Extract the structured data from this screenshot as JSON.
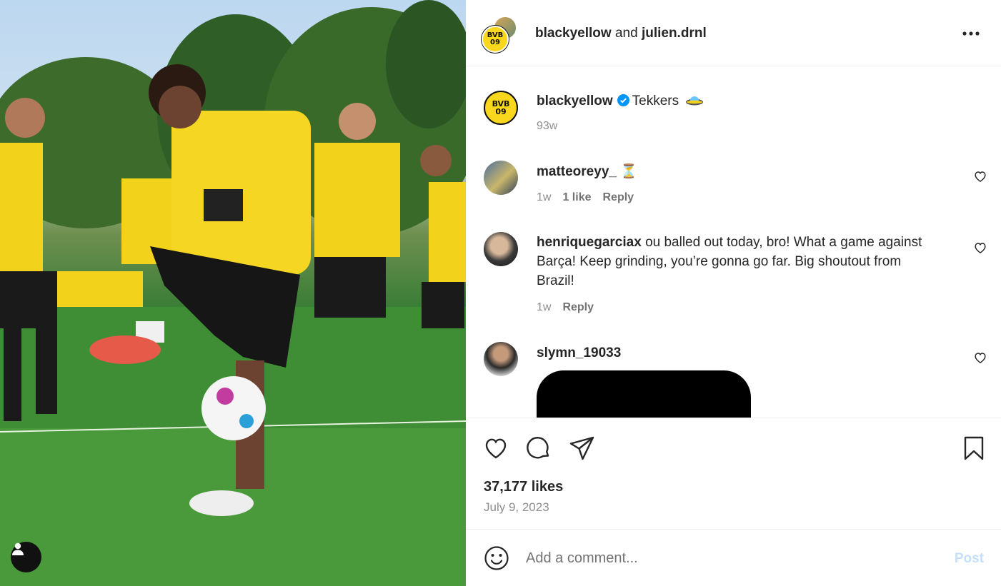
{
  "header": {
    "owner": "blackyellow",
    "joiner": "and",
    "collaborator": "julien.drnl",
    "more_icon": "more-horizontal-icon"
  },
  "caption": {
    "username": "blackyellow",
    "verified": true,
    "text": "Tekkers",
    "time": "93w"
  },
  "comments": [
    {
      "username": "matteoreyy_",
      "text": "⏳",
      "time": "1w",
      "likes": "1 like",
      "reply": "Reply"
    },
    {
      "username": "henriquegarciax",
      "text": "ou balled out today, bro! What a game against Barça! Keep grinding, you’re gonna go far. Big shoutout from Brazil!",
      "time": "1w",
      "reply": "Reply"
    },
    {
      "username": "slymn_19033",
      "text": ""
    }
  ],
  "actions": {
    "likes": "37,177 likes",
    "date": "July 9, 2023",
    "icons": [
      "heart-icon",
      "comment-icon",
      "share-icon",
      "bookmark-icon"
    ]
  },
  "comment_box": {
    "placeholder": "Add a comment...",
    "post_label": "Post"
  },
  "colors": {
    "brand_yellow": "#f9d71c",
    "verified_blue": "#0095f6",
    "post_disabled": "#c4dffc"
  }
}
